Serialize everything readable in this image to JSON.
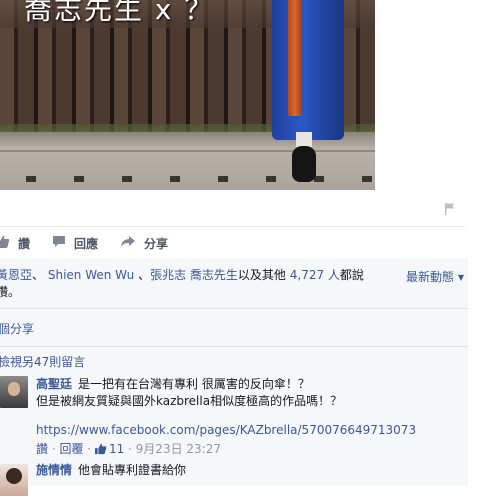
{
  "photo": {
    "overlay_text": "喬志先生 x ？"
  },
  "actions": {
    "like": "讚",
    "comment": "回應",
    "share": "分享"
  },
  "likes": {
    "name1": "黃恩亞",
    "sep1": "、",
    "name2": "Shien Wen Wu",
    "sep2": "、",
    "name3": "張兆志 喬志先生",
    "connector": "以及其他",
    "count": "4,727 人",
    "tail": "都說",
    "line2": "讚。",
    "sort": "最新動態"
  },
  "shares": {
    "text": "個分享"
  },
  "more_comments": {
    "text": "檢視另47則留言"
  },
  "comments": [
    {
      "author": "高聖廷",
      "line1": "是一把有在台灣有專利 很厲害的反向傘！？",
      "line2": "但是被網友質疑與國外kazbrella相似度極高的作品嗎！？",
      "link": "https://www.facebook.com/pages/KAZbrella/570076649713073",
      "like_label": "讚",
      "reply_label": "回覆",
      "like_count": "11",
      "date": "9月23日 23:27"
    },
    {
      "author": "施情情",
      "text": "他會貼專利證書給你"
    }
  ],
  "icons": {
    "flag": "flag-icon",
    "like": "thumbs-up-icon",
    "comment": "speech-bubble-icon",
    "share": "share-arrow-icon",
    "sort_caret": "caret-down-icon"
  },
  "colors": {
    "link": "#3b5998",
    "meta": "#9197a3",
    "action": "#4e5665",
    "panel_bg": "#f6f7f9"
  }
}
